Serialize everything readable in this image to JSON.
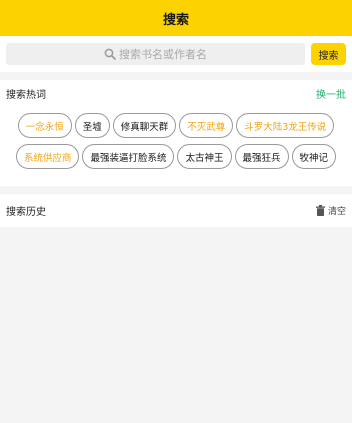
{
  "header": {
    "title": "搜索"
  },
  "search": {
    "placeholder": "搜索书名或作者名",
    "button_label": "搜索"
  },
  "hot": {
    "title": "搜索热词",
    "refresh_label": "换一批",
    "rows": [
      [
        {
          "label": "一念永恒",
          "style": "highlight"
        },
        {
          "label": "圣墟",
          "style": "normal"
        },
        {
          "label": "修真聊天群",
          "style": "normal"
        },
        {
          "label": "不灭武尊",
          "style": "highlight"
        },
        {
          "label": "斗罗大陆3龙王传说",
          "style": "highlight"
        }
      ],
      [
        {
          "label": "系统供应商",
          "style": "highlight"
        },
        {
          "label": "最强装逼打脸系统",
          "style": "normal"
        },
        {
          "label": "太古神王",
          "style": "normal"
        },
        {
          "label": "最强狂兵",
          "style": "normal"
        },
        {
          "label": "牧神记",
          "style": "normal"
        }
      ]
    ]
  },
  "history": {
    "title": "搜索历史",
    "clear_label": "清空"
  },
  "colors": {
    "accent": "#fcd200",
    "highlight_tag": "#f2a416",
    "refresh": "#27b36f"
  }
}
